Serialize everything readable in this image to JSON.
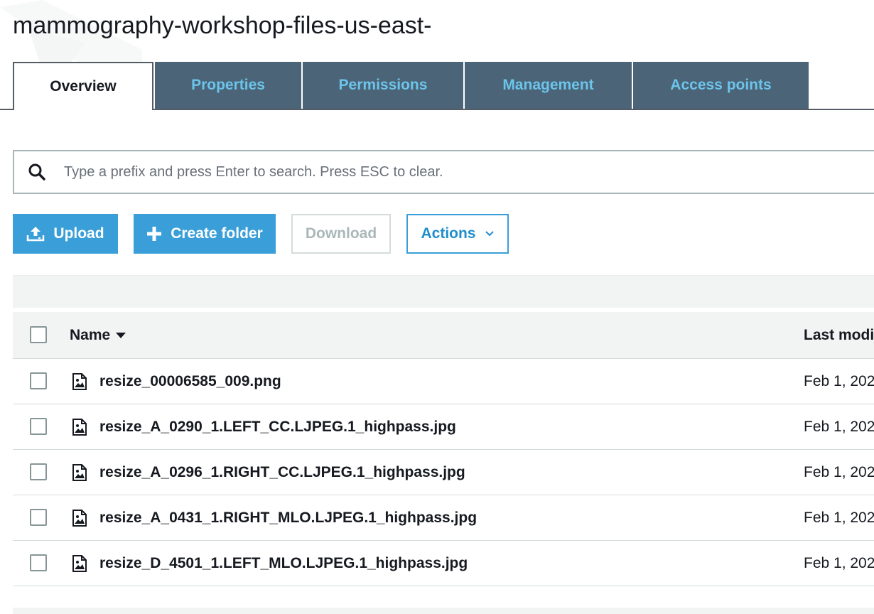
{
  "header": {
    "bucket_title": "mammography-workshop-files-us-east-"
  },
  "tabs": [
    {
      "label": "Overview",
      "active": true
    },
    {
      "label": "Properties",
      "active": false
    },
    {
      "label": "Permissions",
      "active": false
    },
    {
      "label": "Management",
      "active": false
    },
    {
      "label": "Access points",
      "active": false
    }
  ],
  "search": {
    "icon": "search-icon",
    "placeholder": "Type a prefix and press Enter to search. Press ESC to clear.",
    "value": ""
  },
  "toolbar": {
    "upload_label": "Upload",
    "upload_icon": "upload-icon",
    "create_folder_label": "Create folder",
    "create_folder_icon": "plus-icon",
    "download_label": "Download",
    "actions_label": "Actions",
    "actions_icon": "chevron-down-icon"
  },
  "table": {
    "columns": {
      "name": "Name",
      "last_modified": "Last modi"
    },
    "rows": [
      {
        "name": "resize_00006585_009.png",
        "last_modified": "Feb 1, 202",
        "icon": "image-file-icon"
      },
      {
        "name": "resize_A_0290_1.LEFT_CC.LJPEG.1_highpass.jpg",
        "last_modified": "Feb 1, 202",
        "icon": "image-file-icon"
      },
      {
        "name": "resize_A_0296_1.RIGHT_CC.LJPEG.1_highpass.jpg",
        "last_modified": "Feb 1, 202",
        "icon": "image-file-icon"
      },
      {
        "name": "resize_A_0431_1.RIGHT_MLO.LJPEG.1_highpass.jpg",
        "last_modified": "Feb 1, 202",
        "icon": "image-file-icon"
      },
      {
        "name": "resize_D_4501_1.LEFT_MLO.LJPEG.1_highpass.jpg",
        "last_modified": "Feb 1, 202",
        "icon": "image-file-icon"
      }
    ]
  },
  "colors": {
    "primary_button": "#3a9fd8",
    "tab_background": "#4b6477",
    "tab_text": "#6cc4eb",
    "border": "#545b64"
  }
}
